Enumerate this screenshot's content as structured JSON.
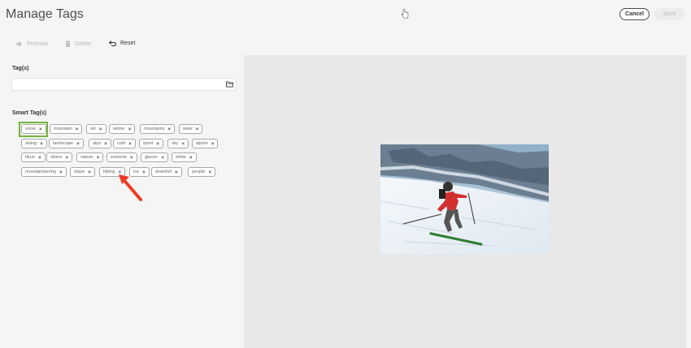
{
  "header": {
    "title": "Manage Tags",
    "cancel_label": "Cancel",
    "save_label": "Save"
  },
  "toolbar": {
    "promote_label": "Promote",
    "delete_label": "Delete",
    "reset_label": "Reset"
  },
  "tags_section": {
    "label": "Tag(s)",
    "input_value": ""
  },
  "smart_tags": {
    "label": "Smart Tag(s)",
    "row1": [
      "snow",
      "mountain",
      "ski",
      "winter",
      "mountains",
      "skier"
    ],
    "row2": [
      "skiing",
      "landscape",
      "alps",
      "cold",
      "sport",
      "sky",
      "alpine"
    ],
    "row3": [
      "bkun",
      "skiers",
      "nature",
      "extreme",
      "glacier",
      "white"
    ],
    "row4": [
      "mountaineering",
      "slope",
      "hiking",
      "ice",
      "downhill",
      "people"
    ]
  },
  "colors": {
    "highlight": "#76b43a",
    "arrow": "#ee3b24",
    "preview_bg": "#e8e8e8"
  },
  "icons": {
    "promote": "megaphone-icon",
    "delete": "trash-icon",
    "reset": "undo-icon",
    "folder": "folder-icon",
    "remove": "close-icon"
  }
}
